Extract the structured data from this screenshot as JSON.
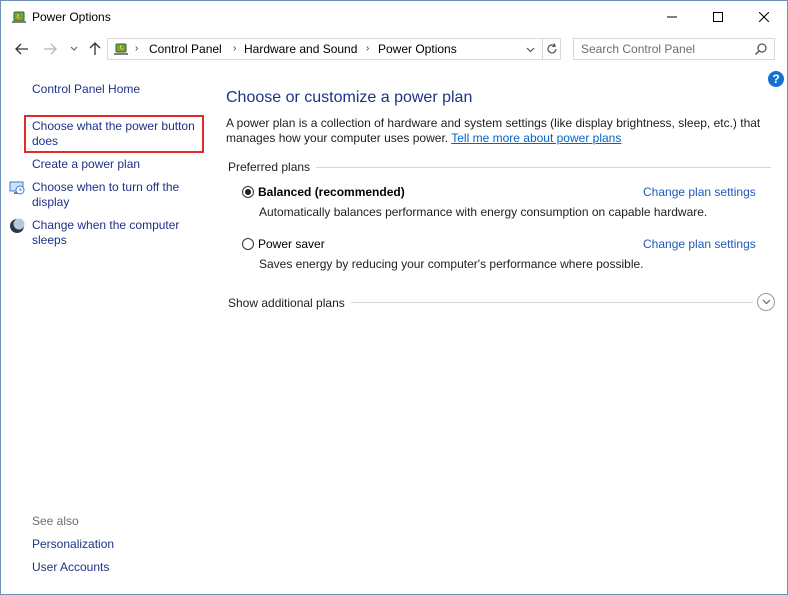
{
  "window": {
    "title": "Power Options",
    "controls": {
      "minimize": "minimize-icon",
      "maximize": "maximize-icon",
      "close": "close-icon"
    }
  },
  "nav": {
    "breadcrumbs": [
      "Control Panel",
      "Hardware and Sound",
      "Power Options"
    ],
    "search_placeholder": "Search Control Panel"
  },
  "sidebar": {
    "home": "Control Panel Home",
    "links": {
      "power_button": "Choose what the power button does",
      "create_plan": "Create a power plan",
      "display_off": "Choose when to turn off the display",
      "sleep": "Change when the computer sleeps"
    },
    "see_also_label": "See also",
    "see_also": [
      "Personalization",
      "User Accounts"
    ]
  },
  "main": {
    "title": "Choose or customize a power plan",
    "description": "A power plan is a collection of hardware and system settings (like display brightness, sleep, etc.) that manages how your computer uses power.",
    "learn_more": "Tell me more about power plans",
    "preferred_label": "Preferred plans",
    "plans": [
      {
        "name": "Balanced (recommended)",
        "description": "Automatically balances performance with energy consumption on capable hardware.",
        "link": "Change plan settings",
        "selected": true
      },
      {
        "name": "Power saver",
        "description": "Saves energy by reducing your computer's performance where possible.",
        "link": "Change plan settings",
        "selected": false
      }
    ],
    "show_additional": "Show additional plans"
  },
  "colors": {
    "link_nav": "#1e3287",
    "link_blue": "#0066cc",
    "highlight_box": "#e02929",
    "help_badge": "#1670d2"
  }
}
